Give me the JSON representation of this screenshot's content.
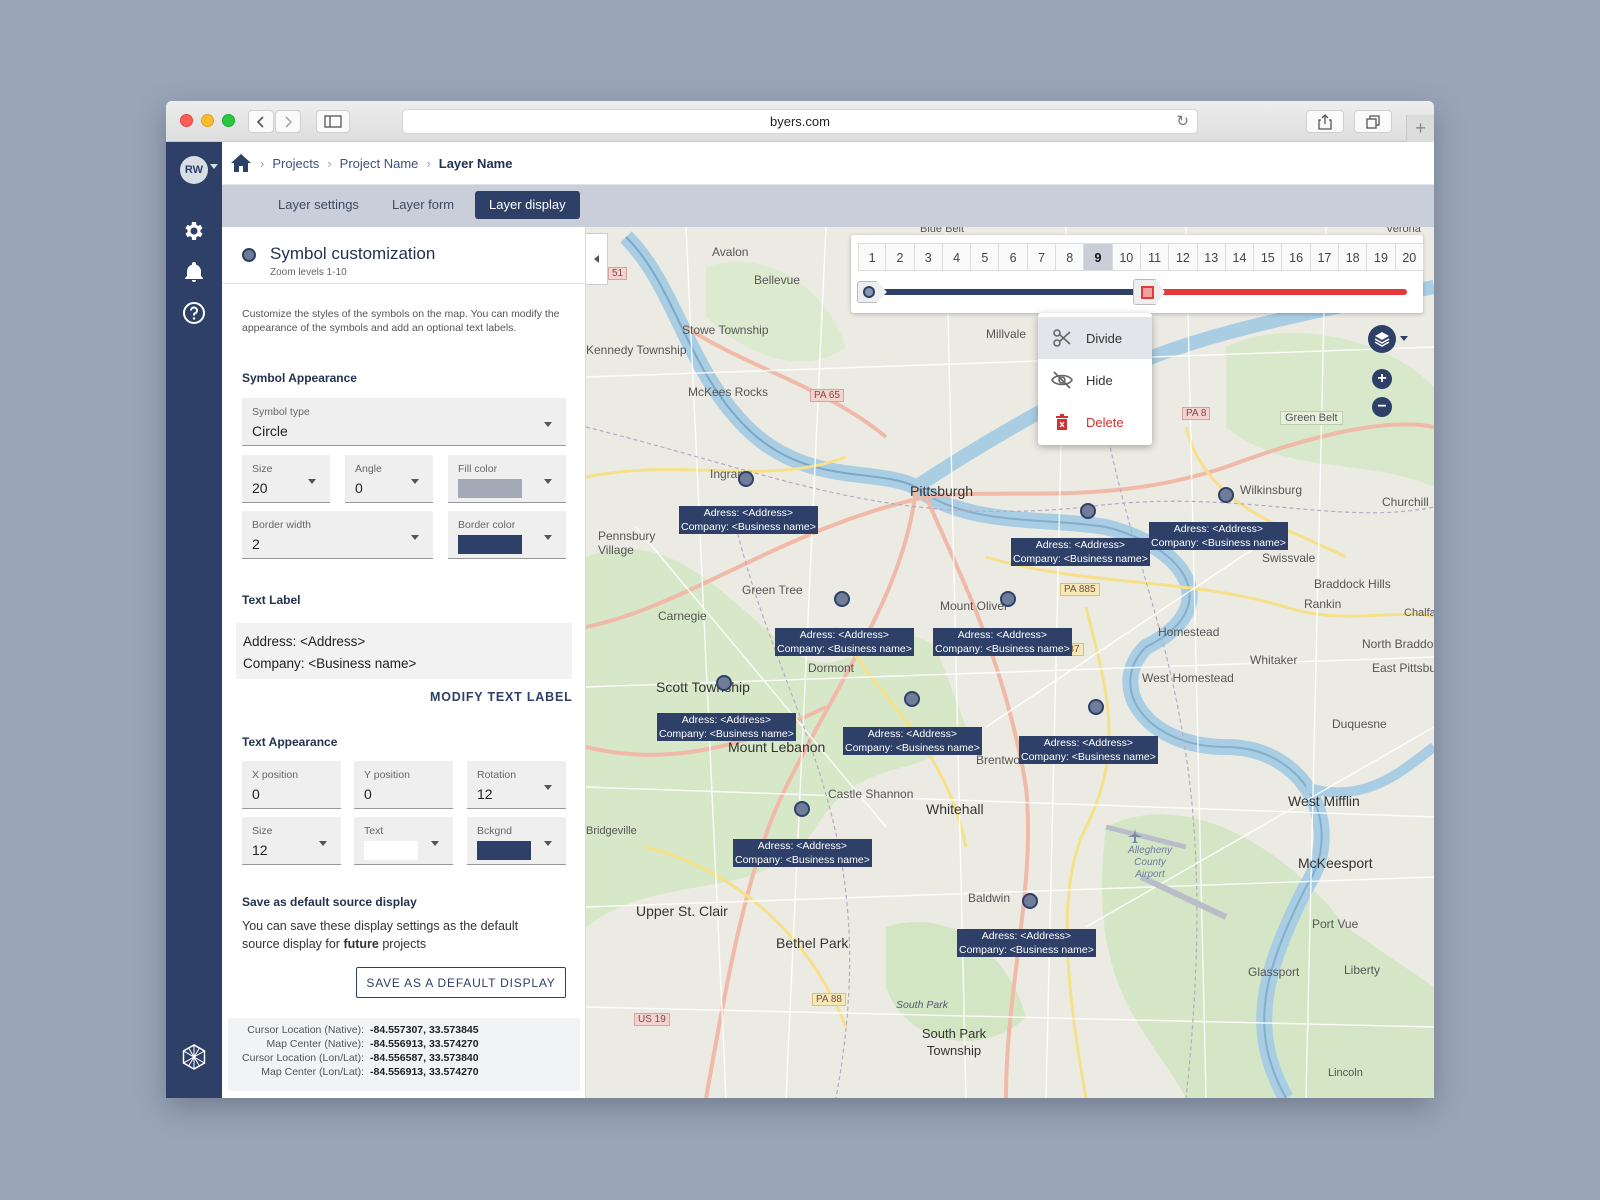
{
  "browser": {
    "url": "byers.com"
  },
  "user": {
    "initials": "RW"
  },
  "breadcrumb": {
    "items": [
      "Projects",
      "Project Name"
    ],
    "current": "Layer Name"
  },
  "tabs": [
    {
      "label": "Layer settings",
      "active": false
    },
    {
      "label": "Layer form",
      "active": false
    },
    {
      "label": "Layer display",
      "active": true
    }
  ],
  "panel": {
    "title": "Symbol customization",
    "subtitle": "Zoom levels 1-10",
    "description": "Customize the styles of the symbols on the map. You can modify the appearance of the symbols and add an optional text labels.",
    "symbol_appearance": {
      "heading": "Symbol Appearance",
      "symbol_type": {
        "label": "Symbol type",
        "value": "Circle"
      },
      "size": {
        "label": "Size",
        "value": "20"
      },
      "angle": {
        "label": "Angle",
        "value": "0"
      },
      "fill_color": {
        "label": "Fill color",
        "value": "#a3a9b6"
      },
      "border_width": {
        "label": "Border width",
        "value": "2"
      },
      "border_color": {
        "label": "Border color",
        "value": "#2e4068"
      }
    },
    "text_label": {
      "heading": "Text Label",
      "line1": "Address: <Address>",
      "line2": "Company: <Business name>",
      "modify_button": "MODIFY TEXT LABEL"
    },
    "text_appearance": {
      "heading": "Text Appearance",
      "x_position": {
        "label": "X position",
        "value": "0"
      },
      "y_position": {
        "label": "Y position",
        "value": "0"
      },
      "rotation": {
        "label": "Rotation",
        "value": "12"
      },
      "size": {
        "label": "Size",
        "value": "12"
      },
      "text": {
        "label": "Text",
        "value": "#ffffff"
      },
      "background": {
        "label": "Bckgnd",
        "value": "#2e4068"
      }
    },
    "save_default": {
      "heading": "Save as default source display",
      "text_before": "You can save these display settings as the default source display for ",
      "text_bold": "future",
      "text_after": " projects",
      "button": "SAVE AS A DEFAULT DISPLAY"
    },
    "coordinates": [
      {
        "label": "Cursor Location (Native):",
        "value": "-84.557307, 33.573845"
      },
      {
        "label": "Map Center (Native):",
        "value": "-84.556913, 33.574270"
      },
      {
        "label": "Cursor Location (Lon/Lat):",
        "value": "-84.556587, 33.573840"
      },
      {
        "label": "Map Center (Lon/Lat):",
        "value": "-84.556913, 33.574270"
      }
    ]
  },
  "zoom_bar": {
    "levels": [
      "1",
      "2",
      "3",
      "4",
      "5",
      "6",
      "7",
      "8",
      "9",
      "10",
      "11",
      "12",
      "13",
      "14",
      "15",
      "16",
      "17",
      "18",
      "19",
      "20"
    ],
    "selected": "9",
    "range_start": "1",
    "range_split": "11"
  },
  "context_menu": {
    "items": [
      "Divide",
      "Hide",
      "Delete"
    ]
  },
  "map": {
    "marker_label_line1": "Adress: <Address>",
    "marker_label_line2": "Company: <Business name>",
    "places": [
      "Avalon",
      "Bellevue",
      "Stowe Township",
      "Kennedy Township",
      "McKees Rocks",
      "Millvale",
      "Ingram",
      "Pittsburgh",
      "Wilkinsburg",
      "Churchill",
      "Pennsbury Village",
      "Green Tree",
      "Carnegie",
      "Mount Oliver",
      "Dormont",
      "Scott Township",
      "Mount Lebanon",
      "Brentwood",
      "Homestead",
      "West Homestead",
      "Whitaker",
      "Rankin",
      "Braddock Hills",
      "Swissvale",
      "North Braddock",
      "East Pittsburgh",
      "Castle Shannon",
      "Whitehall",
      "Duquesne",
      "West Mifflin",
      "McKeesport",
      "Allegheny County Airport",
      "Baldwin",
      "Upper St. Clair",
      "Bethel Park",
      "Port Vue",
      "Glassport",
      "Liberty",
      "South Park",
      "South Park Township",
      "Lincoln",
      "Green Belt",
      "Blue Belt",
      "Verona",
      "Bridgeville",
      "Chalfant"
    ],
    "road_badges": [
      "PA 65",
      "PA 8",
      "PA 885",
      "PA 837",
      "PA 88",
      "US 19",
      "51"
    ]
  }
}
